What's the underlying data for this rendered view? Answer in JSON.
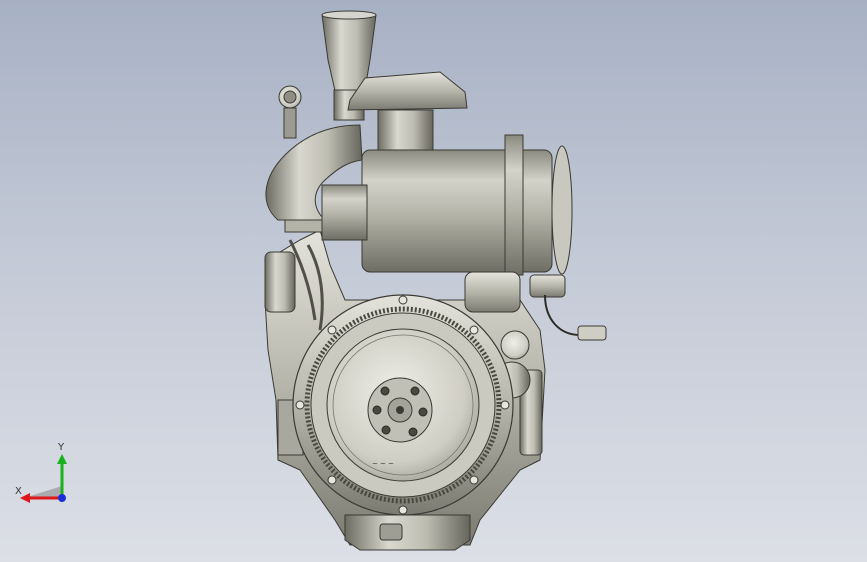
{
  "viewport": {
    "background_top": "#a7b1c4",
    "background_bottom": "#dcdfe6",
    "model": {
      "icon": "engine-3d-model-icon"
    }
  },
  "triad": {
    "x_label": "X",
    "y_label": "Y",
    "x_color": "#e0161b",
    "y_color": "#19b21a",
    "z_color": "#1a2fd6"
  },
  "flywheel_marking": "~ ~ ~"
}
